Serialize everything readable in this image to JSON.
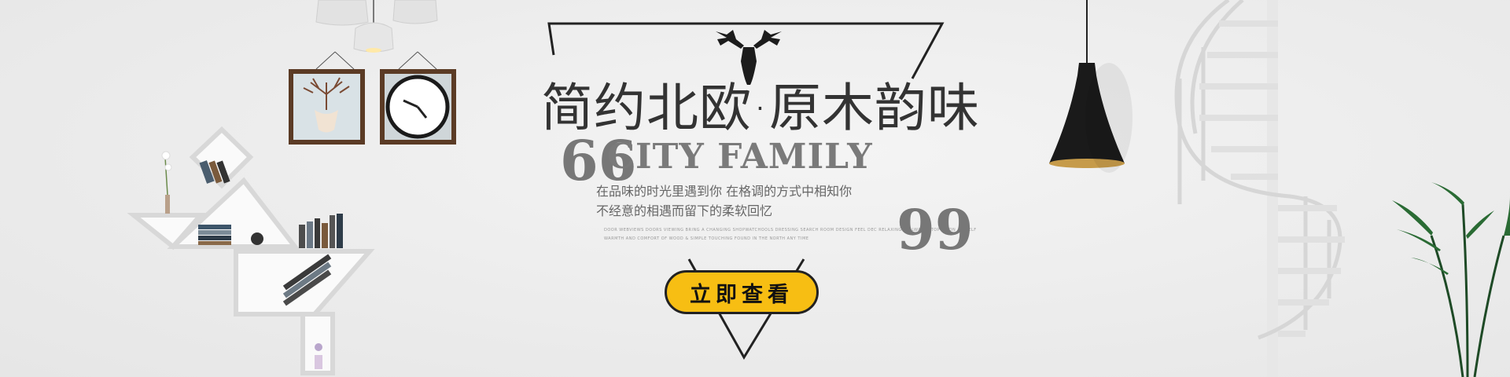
{
  "banner": {
    "title": "简约北欧·原木韵味",
    "subtitle": "CITY FAMILY",
    "quote_open": "66",
    "quote_close": "99",
    "description_line1": "在品味的时光里遇到你 在格调的方式中相知你",
    "description_line2": "不经意的相遇而留下的柔软回忆",
    "fine_print_line1": "DOOR WEBVIEWS DOORS VIEWING BRING A CHANGING SHOPWATCHOOLS DRESSING SEARCH ROOM DESIGN FEEL DEC RELAXING & ALWAYS STOP BY ON A SHELF",
    "fine_print_line2": "WARMTH AND COMFORT OF WOOD & SIMPLE TOUCHING FOUND IN THE NORTH ANY TIME",
    "cta_label": "立即查看"
  },
  "colors": {
    "background": "#ededed",
    "accent": "#f7be13",
    "title_text": "#333333",
    "subtitle_text": "#7a7a7a"
  },
  "icons": {
    "deer_head": "deer-head-icon",
    "clock": "wall-clock",
    "pendant_lamp": "pendant-lamp",
    "spiral_stair": "spiral-staircase",
    "plant": "potted-plant"
  }
}
